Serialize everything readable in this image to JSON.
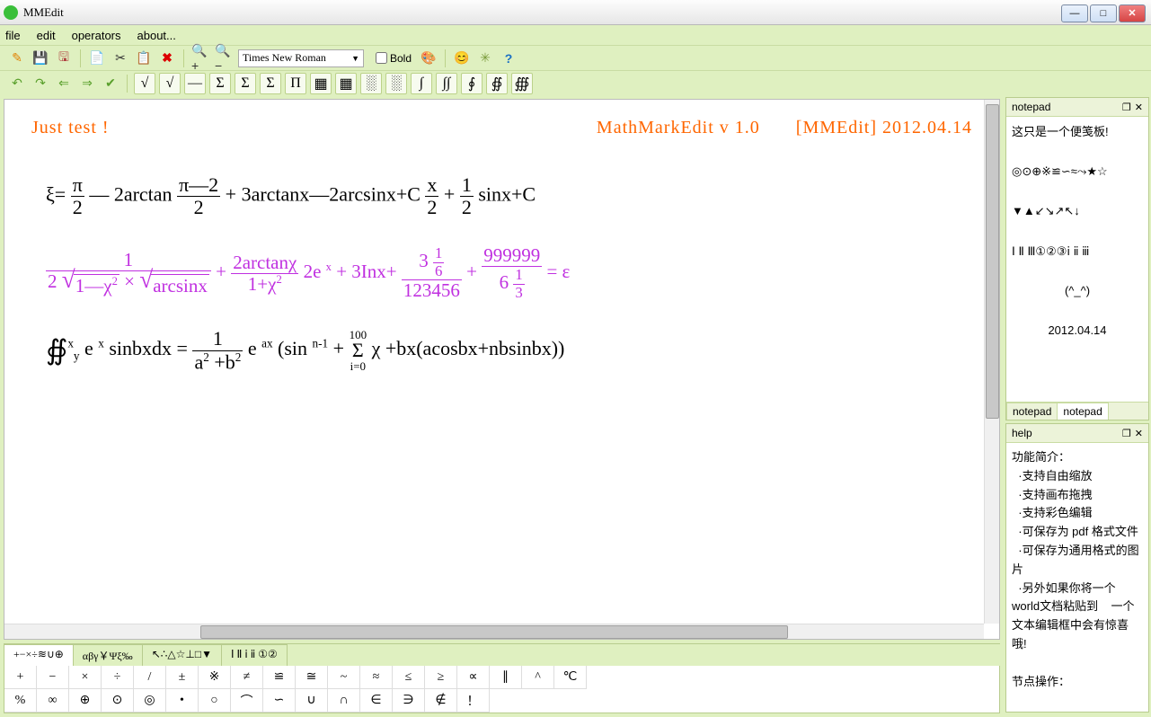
{
  "title": "MMEdit",
  "menu": {
    "file": "file",
    "edit": "edit",
    "operators": "operators",
    "about": "about..."
  },
  "toolbar1": {
    "font": "Times New Roman",
    "bold": "Bold"
  },
  "toolbar2": {
    "symbols": [
      "√",
      "√",
      "—",
      "Σ",
      "Σ",
      "Σ",
      "Π",
      "▦",
      "▦",
      "░",
      "░",
      "∫",
      "∫∫",
      "∮",
      "∯",
      "∰"
    ]
  },
  "header": {
    "left": "Just  test !",
    "mid": "MathMarkEdit v 1.0",
    "right": "[MMEdit]  2012.04.14"
  },
  "eq1": {
    "t1": "ξ=",
    "pi": "π",
    "two": "2",
    "minus2": "— 2arctan ",
    "pin2": "π—2",
    "plus3": " + 3arctanx—2arcsinx+C ",
    "x": "x",
    "plus": " + ",
    "one": "1",
    "sinx": " sinx+C"
  },
  "eq2": {
    "num1": "1",
    "den1a": "2",
    "one_minus_chi2": "1—χ",
    "sq": "2",
    "arcsinx": "arcsinx",
    "times": " × ",
    "plus": " + ",
    "num2": "2arctanχ",
    "den2": "1+χ",
    "e2": "2",
    "expr2": " 2e ",
    "xexp": "x",
    "plus3Inx": "  +  3Inx+ ",
    "threeonesix_top_left": "3",
    "tos_num": "1",
    "tos_den": "6",
    "denom": "123456",
    "plus2": " + ",
    "nines": "999999",
    "six": "6",
    "onethird_num": "1",
    "onethird_den": "3",
    "eq": " = ε"
  },
  "eq3": {
    "int": "∯",
    "xsup": "x",
    "ysub": "y",
    "ex": " e ",
    "xexp": "x",
    "sinbxdx": " sinbxdx = ",
    "one": "1",
    "a": "a",
    "two": "2",
    "plus": " +b",
    "b2": "2",
    "eax": " e ",
    "ax": "ax",
    "lpar": " (sin ",
    "n1": "n-1",
    "sigma_top": "100",
    "sigma_bot": "i=0",
    "chi": " χ +bx(acosbx+nbsinbx))"
  },
  "sym_tabs": [
    "+−×÷≋∪⊕",
    "αβγ￥Ψξ‰",
    "↖∴△☆⊥□▼",
    "Ⅰ Ⅱ ⅰ ⅱ ①②"
  ],
  "sym_row1": [
    "+",
    "−",
    "×",
    "÷",
    "/",
    "±",
    "※",
    "≠",
    "≌",
    "≅",
    "~",
    "≈",
    "≤",
    "≥",
    "∝",
    "∥",
    "^",
    "℃"
  ],
  "sym_row2": [
    "%",
    "∞",
    "⊕",
    "⊙",
    "◎",
    "•",
    "○",
    "⌒",
    "∽",
    "∪",
    "∩",
    "∈",
    "∋",
    "∉",
    "！"
  ],
  "notepad": {
    "title": "notepad",
    "line1": "这只是一个便笺板!",
    "line2": "◎⊙⊕※≌∽≈⤳★☆",
    "line3": "▼▲↙↘↗↖↓",
    "line4": "Ⅰ Ⅱ Ⅲ①②③ⅰ ⅱ ⅲ",
    "line5": "(^_^)",
    "date": "2012.04.14",
    "tab1": "notepad",
    "tab2": "notepad"
  },
  "help": {
    "title": "help",
    "body": "功能简介：\n  ·支持自由缩放\n  ·支持画布拖拽\n  ·支持彩色编辑\n  ·可保存为 pdf 格式文件\n  ·可保存为通用格式的图片\n  ·另外如果你将一个world文档粘贴到    一个文本编辑框中会有惊喜哦!\n\n节点操作："
  }
}
